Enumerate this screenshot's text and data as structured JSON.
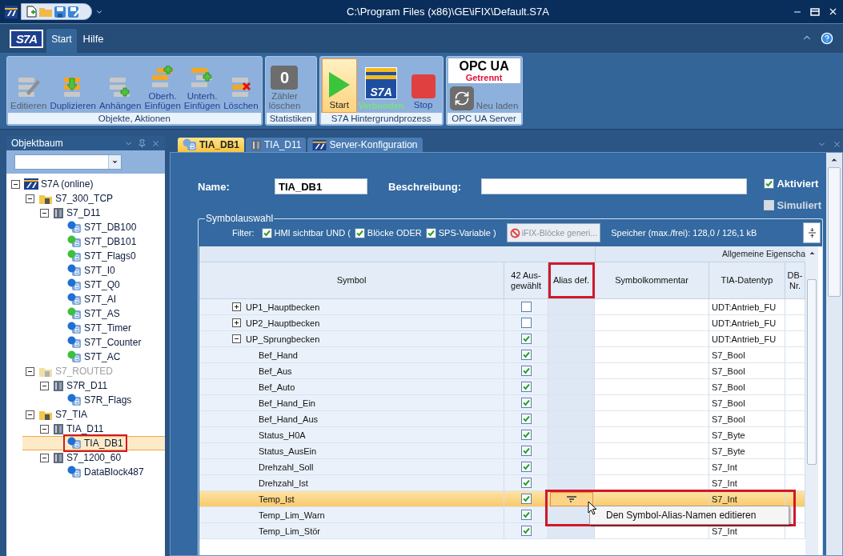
{
  "window": {
    "title": "C:\\Program Files (x86)\\GE\\iFIX\\Default.S7A"
  },
  "ribbon": {
    "logo": "S7A",
    "tabs": [
      {
        "label": "Start",
        "selected": true
      },
      {
        "label": "Hilfe",
        "selected": false
      }
    ],
    "groups": [
      {
        "label": "Objekte, Aktionen",
        "buttons": [
          {
            "kind": "edit",
            "label": "Editieren",
            "disabled": true
          },
          {
            "kind": "duplicate",
            "label": "Duplizieren",
            "disabled": false
          },
          {
            "kind": "append",
            "label": "Anhängen",
            "disabled": false
          },
          {
            "kind": "insert_above",
            "label": "Oberh.\nEinfügen",
            "disabled": false
          },
          {
            "kind": "insert_below",
            "label": "Unterh.\nEinfügen",
            "disabled": false
          },
          {
            "kind": "delete",
            "label": "Löschen",
            "disabled": false
          }
        ]
      },
      {
        "label": "Statistiken",
        "buttons": [
          {
            "kind": "counter",
            "value": "0",
            "label": "Zähler\nlöschen",
            "disabled": true
          }
        ]
      },
      {
        "label": "S7A Hintergrundprozess",
        "buttons": [
          {
            "kind": "start",
            "label": "Start",
            "active": true
          },
          {
            "kind": "status",
            "logo": "S7A",
            "label": "Verbunden",
            "color": "#7ee07e"
          },
          {
            "kind": "stop",
            "label": "Stop",
            "active": false
          }
        ]
      },
      {
        "label": "OPC UA Server",
        "buttons": [
          {
            "kind": "opc",
            "logo": "OPC UA",
            "label": "Getrennt",
            "color": "#e0103c"
          },
          {
            "kind": "reload",
            "label": "Neu laden",
            "disabled": true
          }
        ]
      }
    ]
  },
  "sidebar": {
    "title": "Objektbaum",
    "tree": [
      {
        "label": "S7A (online)",
        "kind": "root",
        "expanded": true,
        "selected": false,
        "children": [
          {
            "label": "S7_300_TCP",
            "kind": "folder",
            "expanded": true,
            "selected": false,
            "children": [
              {
                "label": "S7_D11",
                "kind": "device",
                "expanded": true,
                "selected": false,
                "children": [
                  {
                    "label": "S7T_DB100",
                    "kind": "block",
                    "color": "#1f6fd6",
                    "selected": false
                  },
                  {
                    "label": "S7T_DB101",
                    "kind": "block",
                    "color": "#3fbf3f",
                    "selected": false
                  },
                  {
                    "label": "S7T_Flags0",
                    "kind": "block",
                    "color": "#3fbf3f",
                    "selected": false
                  },
                  {
                    "label": "S7T_I0",
                    "kind": "block",
                    "color": "#1f6fd6",
                    "selected": false
                  },
                  {
                    "label": "S7T_Q0",
                    "kind": "block",
                    "color": "#1f6fd6",
                    "selected": false
                  },
                  {
                    "label": "S7T_AI",
                    "kind": "block",
                    "color": "#1f6fd6",
                    "selected": false
                  },
                  {
                    "label": "S7T_AS",
                    "kind": "block",
                    "color": "#3fbf3f",
                    "selected": false
                  },
                  {
                    "label": "S7T_Timer",
                    "kind": "block",
                    "color": "#1f6fd6",
                    "selected": false
                  },
                  {
                    "label": "S7T_Counter",
                    "kind": "block",
                    "color": "#1f6fd6",
                    "selected": false
                  },
                  {
                    "label": "S7T_AC",
                    "kind": "block",
                    "color": "#3fbf3f",
                    "selected": false
                  }
                ]
              }
            ]
          },
          {
            "label": "S7_ROUTED",
            "kind": "folder",
            "expanded": true,
            "disabled": true,
            "selected": false,
            "children": [
              {
                "label": "S7R_D11",
                "kind": "device",
                "expanded": true,
                "selected": false,
                "children": [
                  {
                    "label": "S7R_Flags",
                    "kind": "block",
                    "color": "#1f6fd6",
                    "selected": false
                  }
                ]
              }
            ]
          },
          {
            "label": "S7_TIA",
            "kind": "folder",
            "expanded": true,
            "selected": false,
            "children": [
              {
                "label": "TIA_D11",
                "kind": "device",
                "expanded": true,
                "selected": false,
                "children": [
                  {
                    "label": "TIA_DB1",
                    "kind": "block",
                    "color": "#1f6fd6",
                    "selected": true,
                    "highlighted": true
                  }
                ]
              },
              {
                "label": "S7_1200_60",
                "kind": "device",
                "expanded": true,
                "selected": false,
                "children": [
                  {
                    "label": "DataBlock487",
                    "kind": "block",
                    "color": "#1f6fd6",
                    "selected": false
                  }
                ]
              }
            ]
          }
        ]
      }
    ]
  },
  "document_tabs": [
    {
      "label": "TIA_DB1",
      "kind": "block",
      "selected": true
    },
    {
      "label": "TIA_D11",
      "kind": "device",
      "selected": false
    },
    {
      "label": "Server-Konfiguration",
      "kind": "logo",
      "selected": false
    }
  ],
  "form": {
    "name_label": "Name:",
    "name_value": "TIA_DB1",
    "description_label": "Beschreibung:",
    "options": [
      {
        "label": "Aktiviert",
        "checked": true
      },
      {
        "label": "Simuliert",
        "checked": false
      }
    ]
  },
  "symbol_selection": {
    "title": "Symbolauswahl",
    "filter_label": "Filter:",
    "filters": [
      {
        "label": "HMI sichtbar UND (",
        "checked": true
      },
      {
        "label": "Blöcke ODER",
        "checked": true
      },
      {
        "label": "SPS-Variable )",
        "checked": true
      }
    ],
    "generate_button": {
      "label": "iFIX-Blöcke generi...",
      "disabled": true
    },
    "memory": "Speicher (max./frei): 128,0 / 126,1 kB"
  },
  "table": {
    "group_header": "Allgemeine Eigenscha",
    "columns": [
      {
        "label": "Symbol",
        "highlighted": false
      },
      {
        "label": "42 Aus-\ngewählt",
        "highlighted": false
      },
      {
        "label": "Alias def.",
        "highlighted": true
      },
      {
        "label": "Symbolkommentar",
        "highlighted": false
      },
      {
        "label": "TIA-Datentyp",
        "highlighted": false
      },
      {
        "label": "DB-\nNr.",
        "highlighted": false
      }
    ],
    "rows": [
      {
        "symbol": "UP1_Hauptbecken",
        "checked": false,
        "type": "UDT:Antrieb_FU",
        "expanded": false,
        "selected": false
      },
      {
        "symbol": "UP2_Hauptbecken",
        "checked": false,
        "type": "UDT:Antrieb_FU",
        "expanded": false,
        "selected": false
      },
      {
        "symbol": "UP_Sprungbecken",
        "checked": true,
        "type": "UDT:Antrieb_FU",
        "expanded": true,
        "selected": false,
        "children": [
          {
            "symbol": "Bef_Hand",
            "checked": true,
            "type": "S7_Bool",
            "selected": false
          },
          {
            "symbol": "Bef_Aus",
            "checked": true,
            "type": "S7_Bool",
            "selected": false
          },
          {
            "symbol": "Bef_Auto",
            "checked": true,
            "type": "S7_Bool",
            "selected": false
          },
          {
            "symbol": "Bef_Hand_Ein",
            "checked": true,
            "type": "S7_Bool",
            "selected": false
          },
          {
            "symbol": "Bef_Hand_Aus",
            "checked": true,
            "type": "S7_Bool",
            "selected": false
          },
          {
            "symbol": "Status_H0A",
            "checked": true,
            "type": "S7_Byte",
            "selected": false
          },
          {
            "symbol": "Status_AusEin",
            "checked": true,
            "type": "S7_Byte",
            "selected": false
          },
          {
            "symbol": "Drehzahl_Soll",
            "checked": true,
            "type": "S7_Int",
            "selected": false
          },
          {
            "symbol": "Drehzahl_Ist",
            "checked": true,
            "type": "S7_Int",
            "selected": false
          },
          {
            "symbol": "Temp_Ist",
            "checked": true,
            "type": "S7_Int",
            "selected": true
          },
          {
            "symbol": "Temp_Lim_Warn",
            "checked": true,
            "selected": false
          },
          {
            "symbol": "Temp_Lim_Stör",
            "checked": true,
            "type": "S7_Int",
            "selected": false
          }
        ]
      }
    ]
  },
  "context_menu": {
    "label": "Den Symbol-Alias-Namen editieren",
    "highlighted": true
  }
}
